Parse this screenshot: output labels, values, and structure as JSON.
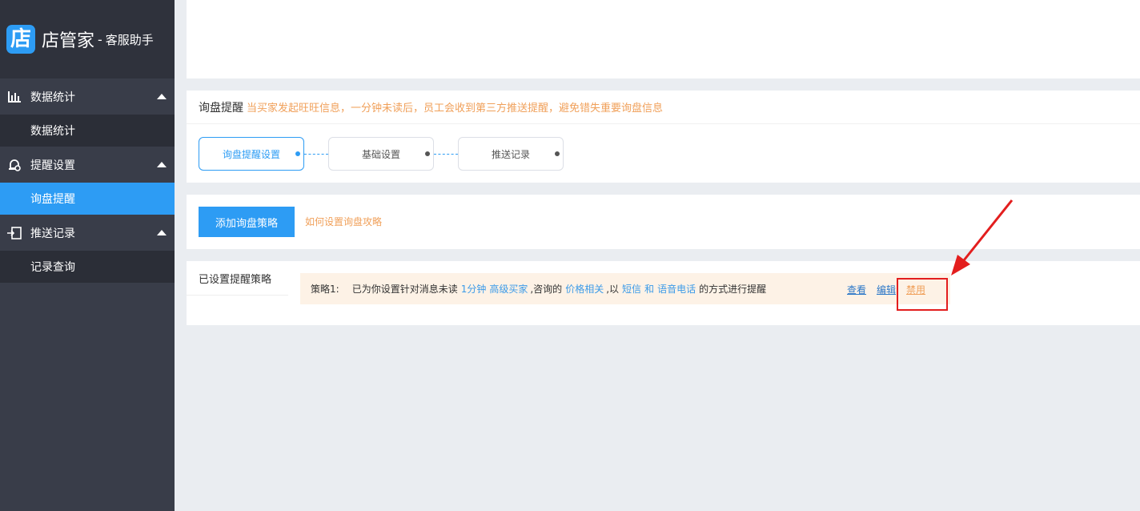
{
  "brand": {
    "logo_char": "店",
    "name": "店管家",
    "separator": "-",
    "subtitle": "客服助手"
  },
  "sidebar": {
    "groups": [
      {
        "label": "数据统计",
        "icon": "bar-chart-icon",
        "items": [
          {
            "label": "数据统计",
            "active": false
          }
        ]
      },
      {
        "label": "提醒设置",
        "icon": "alarm-gear-icon",
        "items": [
          {
            "label": "询盘提醒",
            "active": true
          }
        ]
      },
      {
        "label": "推送记录",
        "icon": "push-record-icon",
        "items": [
          {
            "label": "记录查询",
            "active": false
          }
        ]
      }
    ]
  },
  "notice": {
    "title": "询盘提醒",
    "text": "当买家发起旺旺信息，一分钟未读后，员工会收到第三方推送提醒，避免错失重要询盘信息"
  },
  "steps": [
    {
      "label": "询盘提醒设置",
      "active": true
    },
    {
      "label": "基础设置",
      "active": false
    },
    {
      "label": "推送记录",
      "active": false
    }
  ],
  "actions": {
    "add_label": "添加询盘策略",
    "help_label": "如何设置询盘攻略"
  },
  "policy": {
    "tab_label": "已设置提醒策略",
    "prefix": "策略1:",
    "part1": "已为你设置针对消息未读",
    "time": "1分钟",
    "buyer": "高级买家",
    "part2": ",咨询的",
    "topic": "价格相关",
    "part3": ",以",
    "method1": "短信",
    "and": "和",
    "method2": "语音电话",
    "part4": "的方式进行提醒",
    "view_label": "查看",
    "edit_label": "编辑",
    "disable_label": "禁用"
  },
  "colors": {
    "sidebar_bg": "#393d49",
    "accent": "#2d9cf4",
    "warning_text": "#f0a05a",
    "annotation_red": "#e31e1e"
  }
}
